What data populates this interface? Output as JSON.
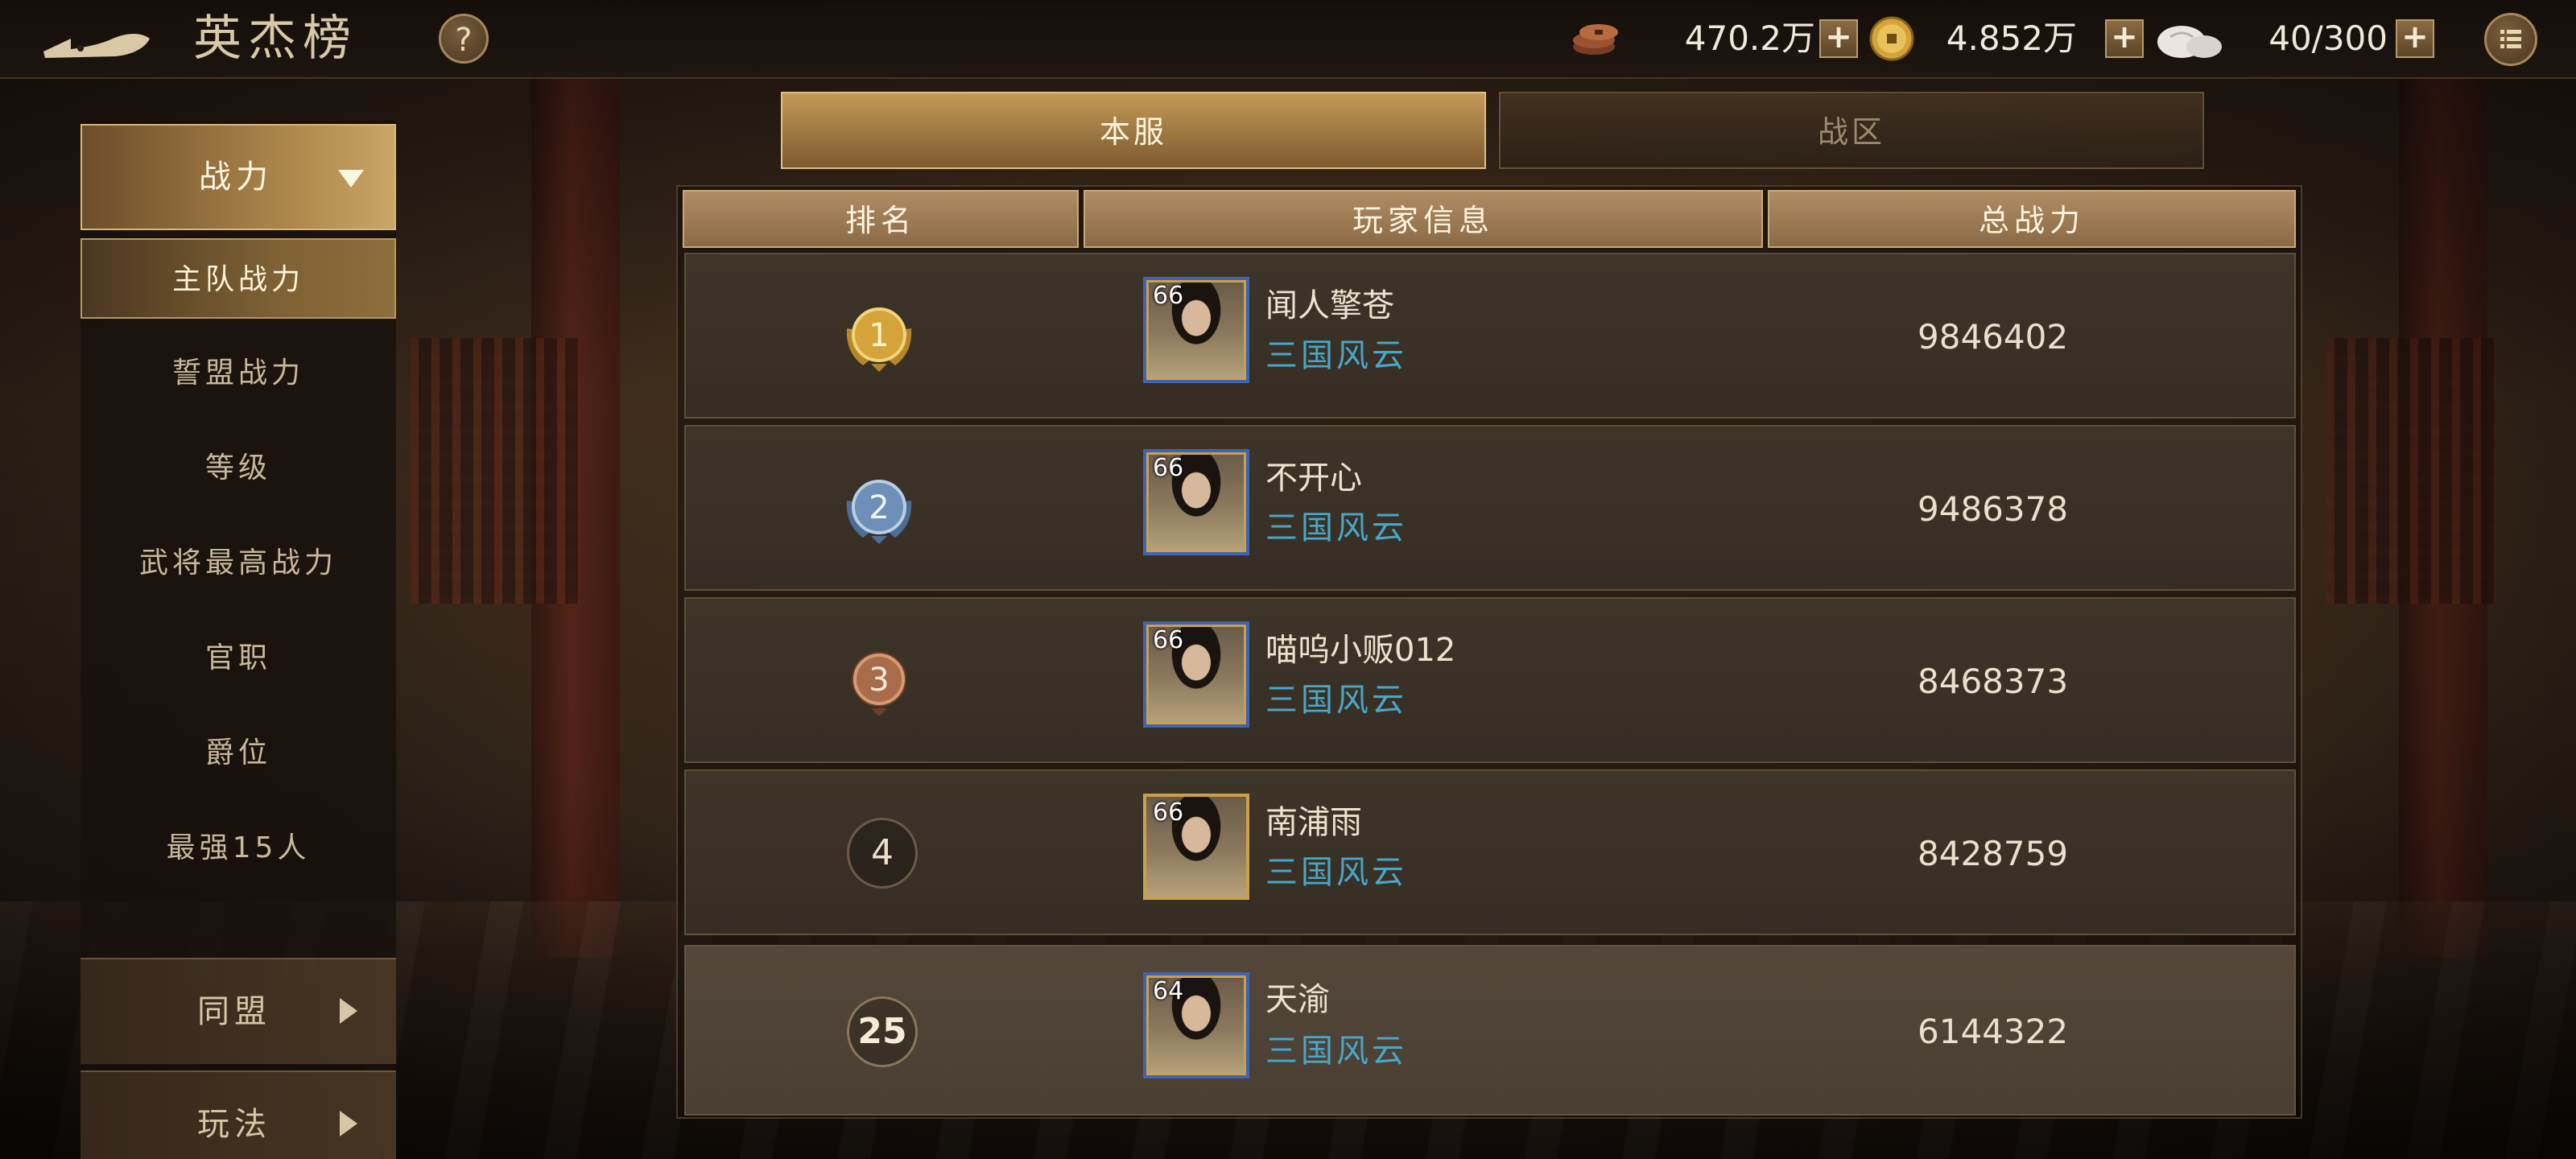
{
  "header": {
    "title": "英杰榜",
    "help_label": "?",
    "resources": [
      {
        "icon": "copper-coins-icon",
        "value": "470.2万",
        "plus": "+"
      },
      {
        "icon": "gold-coin-icon",
        "value": "4.852万",
        "plus": "+"
      },
      {
        "icon": "steamed-bun-icon",
        "value": "40/300",
        "plus": "+"
      }
    ]
  },
  "sidebar": {
    "category_open": {
      "label": "战力"
    },
    "items": [
      {
        "label": "主队战力",
        "active": true
      },
      {
        "label": "誓盟战力"
      },
      {
        "label": "等级"
      },
      {
        "label": "武将最高战力"
      },
      {
        "label": "官职"
      },
      {
        "label": "爵位"
      },
      {
        "label": "最强15人"
      }
    ],
    "collapsed": [
      {
        "label": "同盟"
      },
      {
        "label": "玩法"
      }
    ]
  },
  "tabs": [
    {
      "label": "本服",
      "active": true
    },
    {
      "label": "战区",
      "active": false
    }
  ],
  "table": {
    "headers": [
      "排名",
      "玩家信息",
      "总战力"
    ],
    "rows": [
      {
        "rank": "1",
        "level": "66",
        "name": "闻人擎苍",
        "server": "三国风云",
        "power": "9846402"
      },
      {
        "rank": "2",
        "level": "66",
        "name": "不开心",
        "server": "三国风云",
        "power": "9486378"
      },
      {
        "rank": "3",
        "level": "66",
        "name": "喵呜小贩012",
        "server": "三国风云",
        "power": "8468373"
      },
      {
        "rank": "4",
        "level": "66",
        "name": "南浦雨",
        "server": "三国风云",
        "power": "8428759"
      },
      {
        "rank": "25",
        "level": "64",
        "name": "天渝",
        "server": "三国风云",
        "power": "6144322",
        "is_self": true
      }
    ]
  },
  "colors": {
    "accent_gold": "#c49a58",
    "server_text": "#47a7c9",
    "medal_gold": "#d4a43a",
    "medal_silver": "#6d8fb8",
    "medal_bronze": "#a86c4a"
  }
}
